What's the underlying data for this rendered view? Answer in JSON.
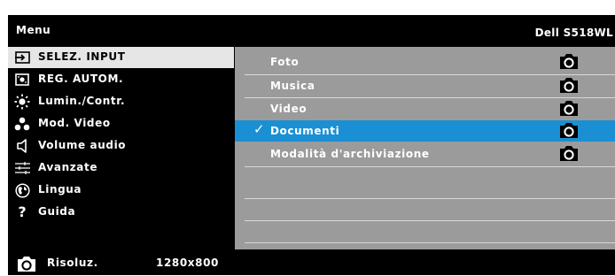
{
  "header": {
    "title": "Menu",
    "model": "Dell S518WL"
  },
  "menu": {
    "items": [
      {
        "label": "SELEZ. INPUT",
        "icon": "input-source-icon",
        "selected": true
      },
      {
        "label": "REG. AUTOM.",
        "icon": "auto-adjust-icon",
        "selected": false
      },
      {
        "label": "Lumin./Contr.",
        "icon": "brightness-icon",
        "selected": false
      },
      {
        "label": "Mod. Video",
        "icon": "video-mode-icon",
        "selected": false
      },
      {
        "label": "Volume audio",
        "icon": "speaker-icon",
        "selected": false
      },
      {
        "label": "Avanzate",
        "icon": "sliders-icon",
        "selected": false
      },
      {
        "label": "Lingua",
        "icon": "globe-icon",
        "selected": false
      },
      {
        "label": "Guida",
        "icon": "question-icon",
        "selected": false
      }
    ]
  },
  "submenu": {
    "items": [
      {
        "label": "Foto",
        "checked": false,
        "highlighted": false
      },
      {
        "label": "Musica",
        "checked": false,
        "highlighted": false
      },
      {
        "label": "Video",
        "checked": false,
        "highlighted": false
      },
      {
        "label": "Documenti",
        "checked": true,
        "highlighted": true
      },
      {
        "label": "Modalità d'archiviazione",
        "checked": false,
        "highlighted": false
      }
    ],
    "check_mark": "✓"
  },
  "footer": {
    "resolution_label": "Risoluz.",
    "resolution_value": "1280x800"
  },
  "colors": {
    "background": "#000000",
    "panel": "#9b9b9b",
    "highlight": "#1b8fd3",
    "selected": "#e6e6e6"
  }
}
